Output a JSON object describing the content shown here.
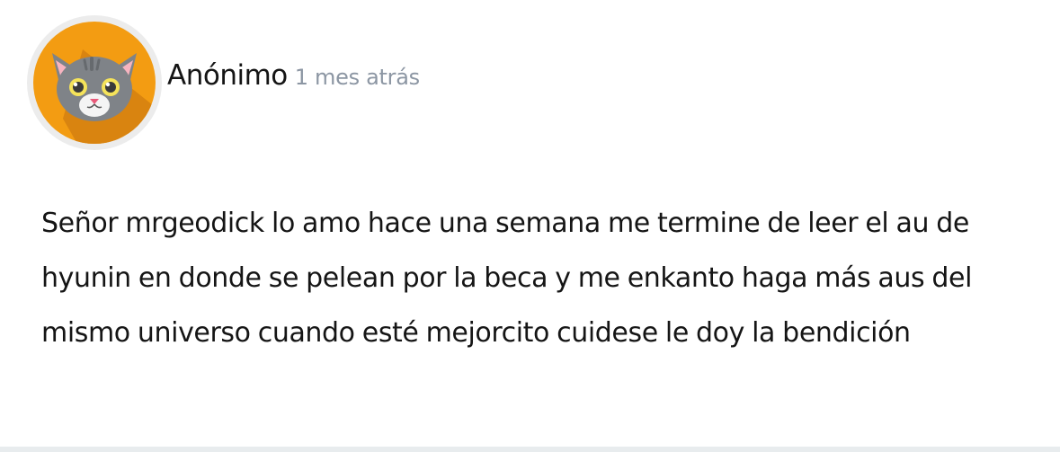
{
  "comment": {
    "author": "Anónimo",
    "timestamp": "1 mes atrás",
    "avatar": {
      "icon": "cat-face-icon",
      "background_color": "#f39c12",
      "ring_color": "#ececec"
    },
    "body": "Señor mrgeodick lo amo hace una semana me termine de leer el au de hyunin en donde se pelean por la beca y me enkanto haga más aus del mismo universo cuando esté mejorcito cuidese le doy la bendición"
  }
}
